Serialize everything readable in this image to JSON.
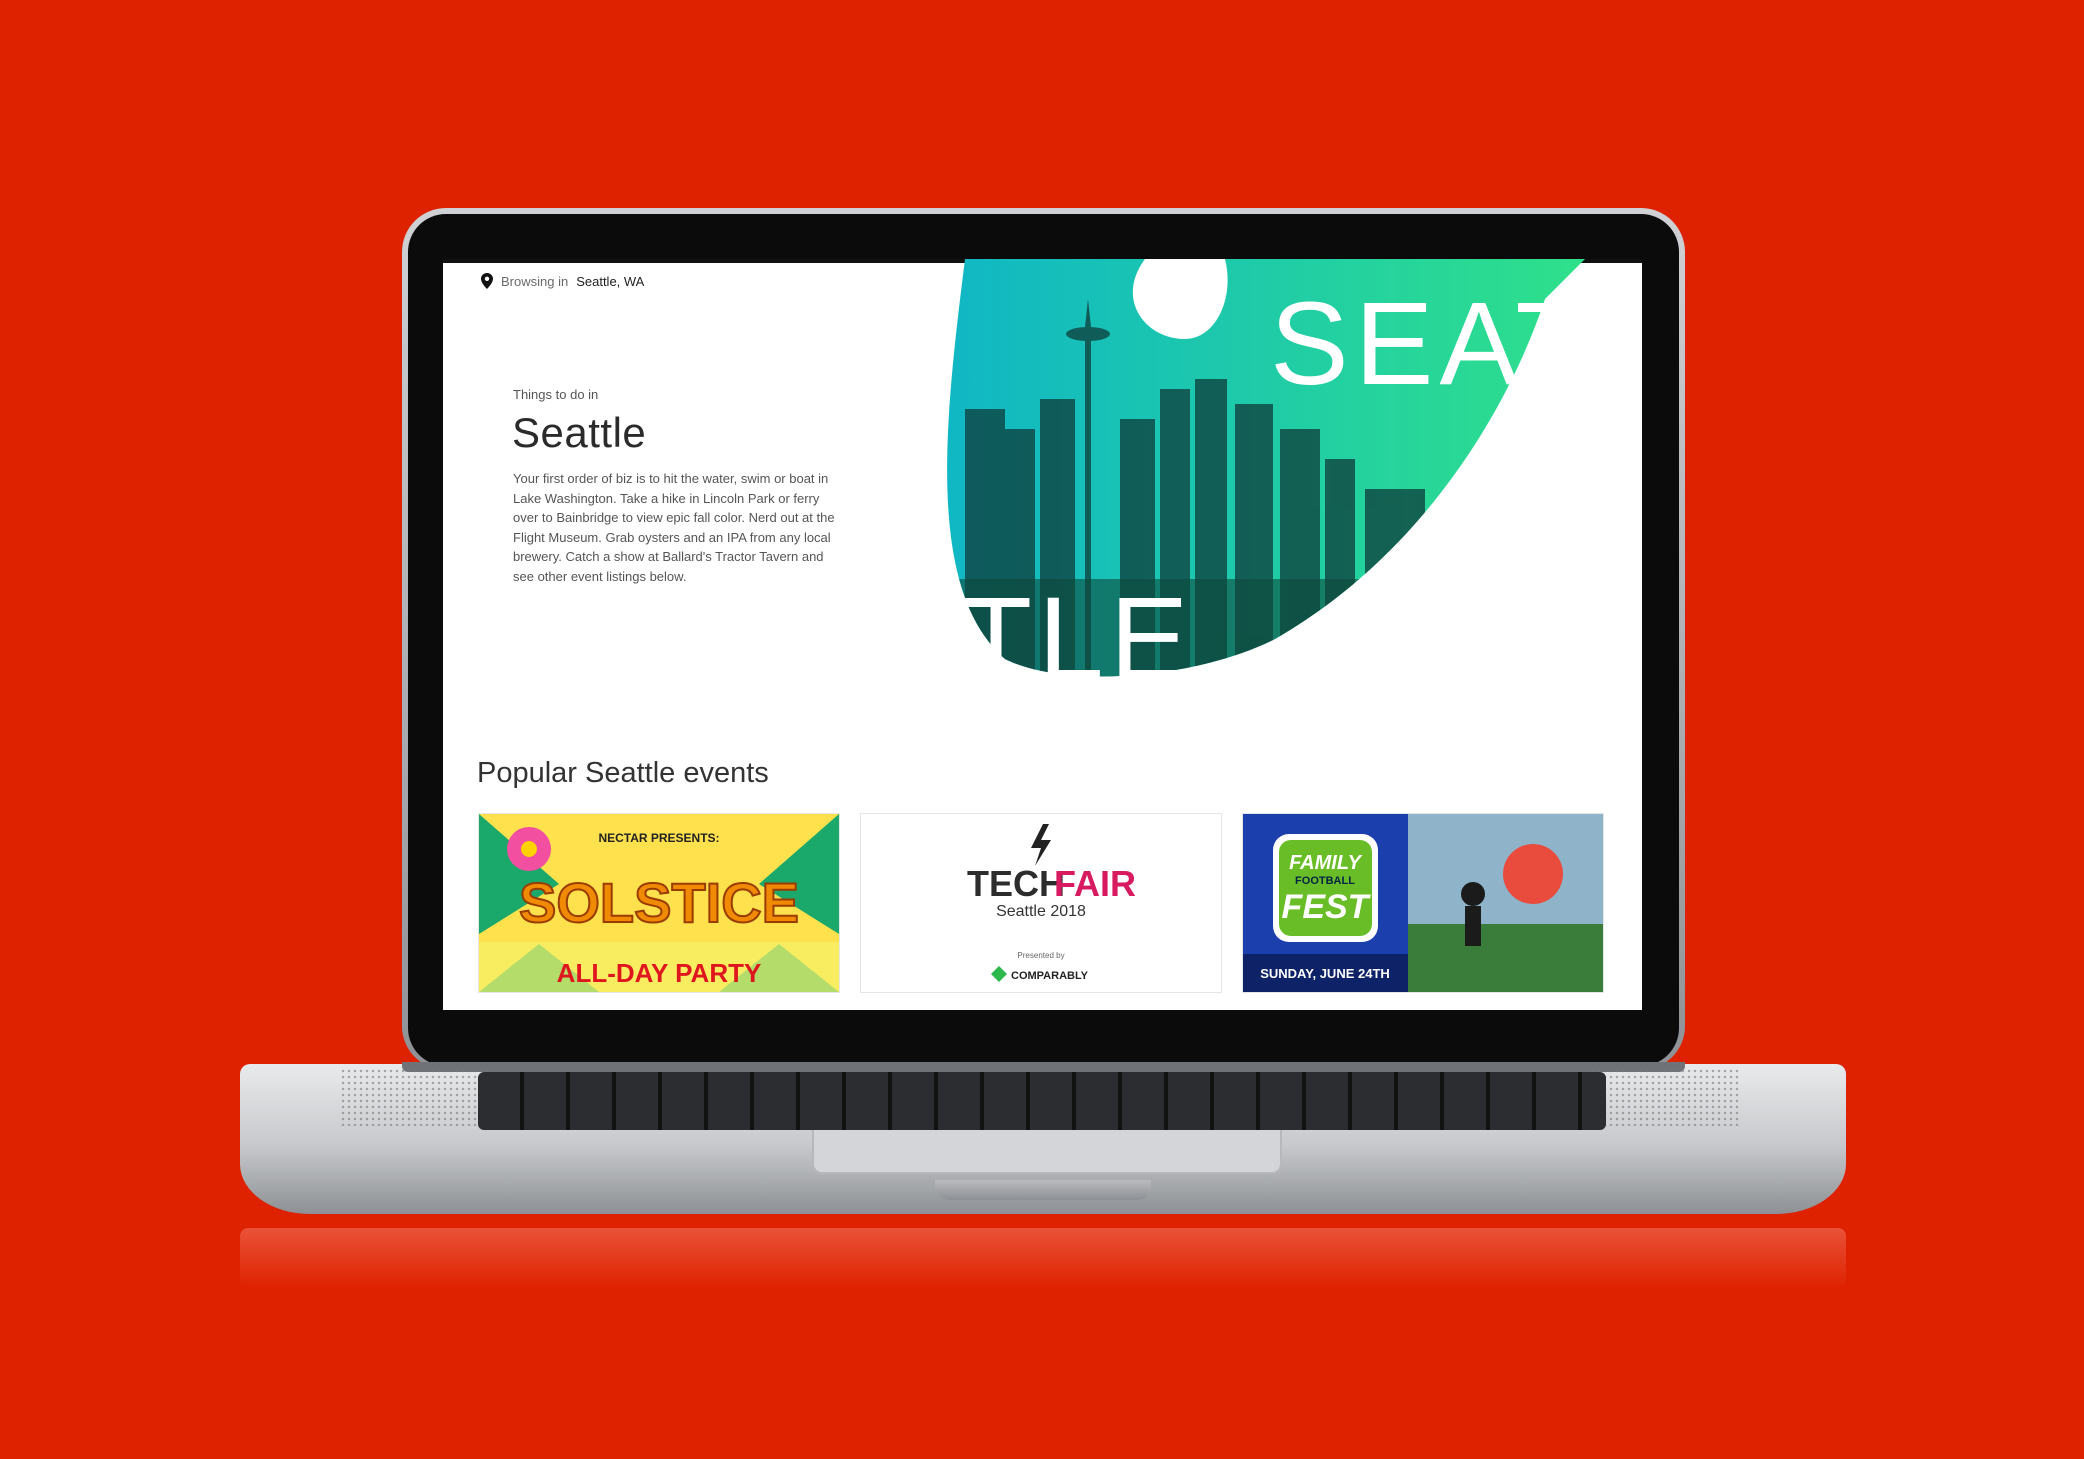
{
  "location": {
    "prefix": "Browsing in",
    "city": "Seattle, WA"
  },
  "hero": {
    "eyebrow": "Things to do in",
    "city": "Seattle",
    "description": "Your first order of biz is to hit the water, swim or boat in Lake Washington. Take a hike in Lincoln Park or ferry over to Bainbridge to view epic fall color. Nerd out at the Flight Museum. Grab oysters and an IPA from any local brewery. Catch a show at Ballard's Tractor Tavern and see other event listings below.",
    "art_top": "SEAT",
    "art_bottom": "TLE"
  },
  "events": {
    "title": "Popular Seattle events",
    "cards": [
      {
        "top": "NECTAR PRESENTS:",
        "main": "SOLSTICE",
        "sub": "ALL-DAY PARTY"
      },
      {
        "main_a": "TECH",
        "main_b": "FAIR",
        "sub": "Seattle 2018",
        "presented": "Presented by",
        "sponsor": "COMPARABLY"
      },
      {
        "line1": "FAMILY",
        "line2": "FOOTBALL",
        "line3": "FEST",
        "date": "SUNDAY, JUNE 24TH"
      }
    ]
  },
  "colors": {
    "background": "#de2200",
    "hero_gradient_start": "#10b7c5",
    "hero_gradient_end": "#2fe08a"
  }
}
